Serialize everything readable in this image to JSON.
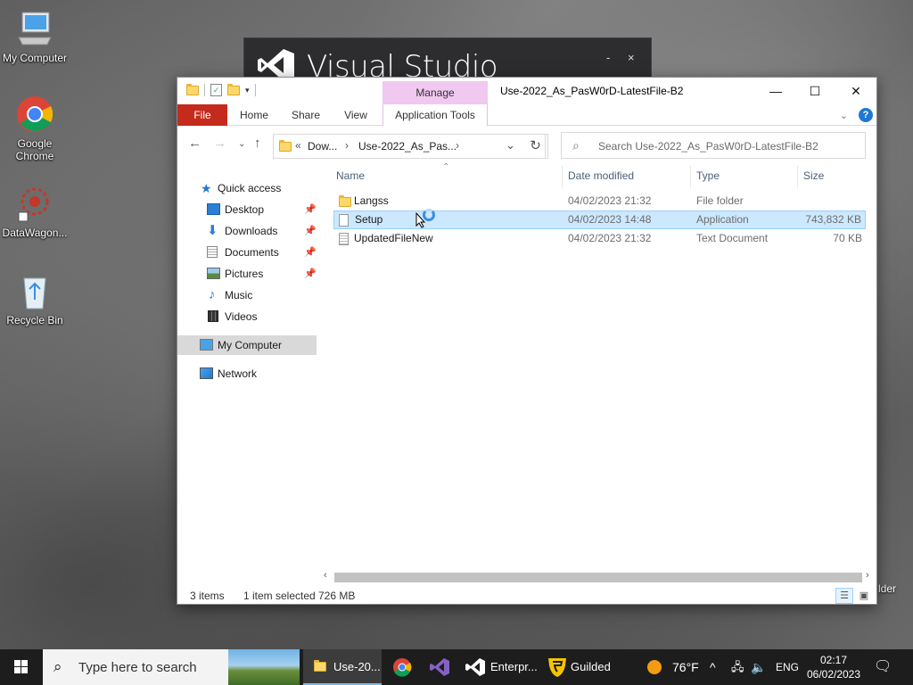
{
  "desktop": {
    "icons": [
      {
        "label": "My Computer"
      },
      {
        "label": "Google Chrome"
      },
      {
        "label": "DataWagon..."
      },
      {
        "label": "Recycle Bin"
      }
    ],
    "partial_label": "lder"
  },
  "vs_splash": {
    "title": "Visual Studio",
    "minimize": "-",
    "close": "×"
  },
  "explorer": {
    "contextual_tab": "Manage",
    "title": "Use-2022_As_PasW0rD-LatestFile-B2",
    "ribbon_tabs": [
      "File",
      "Home",
      "Share",
      "View",
      "Application Tools"
    ],
    "address": {
      "crumbs": [
        "Dow...",
        "Use-2022_As_Pas..."
      ]
    },
    "search": {
      "placeholder": "Search Use-2022_As_PasW0rD-LatestFile-B2"
    },
    "nav": [
      {
        "label": "Quick access",
        "icon": "star-icon"
      },
      {
        "label": "Desktop",
        "icon": "desktop-icon",
        "pinned": true
      },
      {
        "label": "Downloads",
        "icon": "download-icon",
        "pinned": true
      },
      {
        "label": "Documents",
        "icon": "documents-icon",
        "pinned": true
      },
      {
        "label": "Pictures",
        "icon": "pictures-icon",
        "pinned": true
      },
      {
        "label": "Music",
        "icon": "music-icon"
      },
      {
        "label": "Videos",
        "icon": "videos-icon"
      },
      {
        "label": "My Computer",
        "icon": "computer-icon",
        "selected": true
      },
      {
        "label": "Network",
        "icon": "network-icon"
      }
    ],
    "columns": [
      "Name",
      "Date modified",
      "Type",
      "Size"
    ],
    "files": [
      {
        "name": "Langss",
        "date": "04/02/2023 21:32",
        "type": "File folder",
        "size": "",
        "icon": "folder-icon"
      },
      {
        "name": "Setup",
        "date": "04/02/2023 14:48",
        "type": "Application",
        "size": "743,832 KB",
        "icon": "application-icon",
        "selected": true
      },
      {
        "name": "UpdatedFileNew",
        "date": "04/02/2023 21:32",
        "type": "Text Document",
        "size": "70 KB",
        "icon": "text-document-icon"
      }
    ],
    "status": {
      "items": "3 items",
      "selected": "1 item selected",
      "size": "726 MB"
    }
  },
  "taskbar": {
    "search_placeholder": "Type here to search",
    "apps": [
      {
        "label": "Use-20...",
        "icon": "file-explorer-icon",
        "active": true
      },
      {
        "label": "",
        "icon": "chrome-icon"
      },
      {
        "label": "",
        "icon": "visual-studio-icon"
      },
      {
        "label": "Enterpr...",
        "icon": "visual-studio-icon"
      },
      {
        "label": "Guilded",
        "icon": "guilded-icon"
      }
    ],
    "weather": "76°F",
    "language": "ENG",
    "time": "02:17",
    "date": "06/02/2023"
  },
  "colors": {
    "file_tab": "#c42b1c",
    "manage_tab": "#f0c8f0",
    "selection": "#cce8ff",
    "taskbar": "#1d1d1d"
  }
}
